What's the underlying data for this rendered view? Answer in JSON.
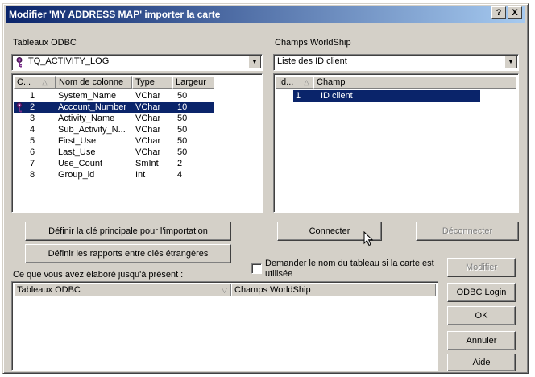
{
  "window": {
    "title": "Modifier 'MY ADDRESS MAP' importer la carte",
    "help_btn": "?",
    "close_btn": "X"
  },
  "left": {
    "label": "Tableaux ODBC",
    "selected_table": "TQ_ACTIVITY_LOG",
    "columns": [
      "C...",
      "Nom de colonne",
      "Type",
      "Largeur"
    ],
    "rows": [
      {
        "c": "1",
        "name": "System_Name",
        "type": "VChar",
        "width": "50"
      },
      {
        "c": "2",
        "name": "Account_Number",
        "type": "VChar",
        "width": "10"
      },
      {
        "c": "3",
        "name": "Activity_Name",
        "type": "VChar",
        "width": "50"
      },
      {
        "c": "4",
        "name": "Sub_Activity_N...",
        "type": "VChar",
        "width": "50"
      },
      {
        "c": "5",
        "name": "First_Use",
        "type": "VChar",
        "width": "50"
      },
      {
        "c": "6",
        "name": "Last_Use",
        "type": "VChar",
        "width": "50"
      },
      {
        "c": "7",
        "name": "Use_Count",
        "type": "SmInt",
        "width": "2"
      },
      {
        "c": "8",
        "name": "Group_id",
        "type": "Int",
        "width": "4"
      }
    ],
    "btn_primary_key": "Définir la clé principale pour l'importation",
    "btn_foreign_keys": "Définir les rapports entre clés étrangères"
  },
  "right": {
    "label": "Champs WorldShip",
    "selected_list": "Liste des ID client",
    "columns": [
      "Id...",
      "Champ"
    ],
    "rows": [
      {
        "id": "1",
        "champ": "ID client"
      }
    ],
    "btn_connect": "Connecter",
    "btn_disconnect": "Déconnecter"
  },
  "ask_table_name": "Demander le nom du tableau si la carte est utilisée",
  "built_label": "Ce que vous avez élaboré jusqu'à présent :",
  "bottom_columns": [
    "Tableaux ODBC",
    "Champs WorldShip"
  ],
  "side_buttons": {
    "modify": "Modifier",
    "odbc_login": "ODBC Login",
    "ok": "OK",
    "cancel": "Annuler",
    "help": "Aide"
  }
}
